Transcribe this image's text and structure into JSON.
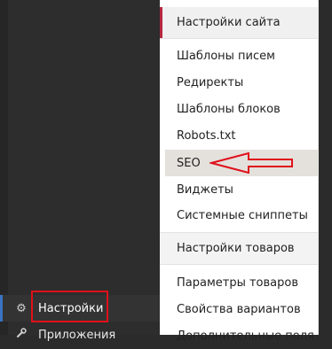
{
  "sidebar": {
    "items": [
      {
        "label": "Настройки",
        "icon": "gear-icon"
      },
      {
        "label": "Приложения",
        "icon": "wrench-icon"
      }
    ]
  },
  "submenu": {
    "groups": [
      {
        "header": "Настройки сайта",
        "items": [
          "Шаблоны писем",
          "Редиректы",
          "Шаблоны блоков",
          "Robots.txt",
          "SEO",
          "Виджеты",
          "Системные сниппеты"
        ]
      },
      {
        "header": "Настройки товаров",
        "items": [
          "Параметры товаров",
          "Свойства вариантов",
          "Дополнительные поля"
        ]
      }
    ],
    "highlighted": "SEO"
  },
  "annotation_color": "#e0101a"
}
